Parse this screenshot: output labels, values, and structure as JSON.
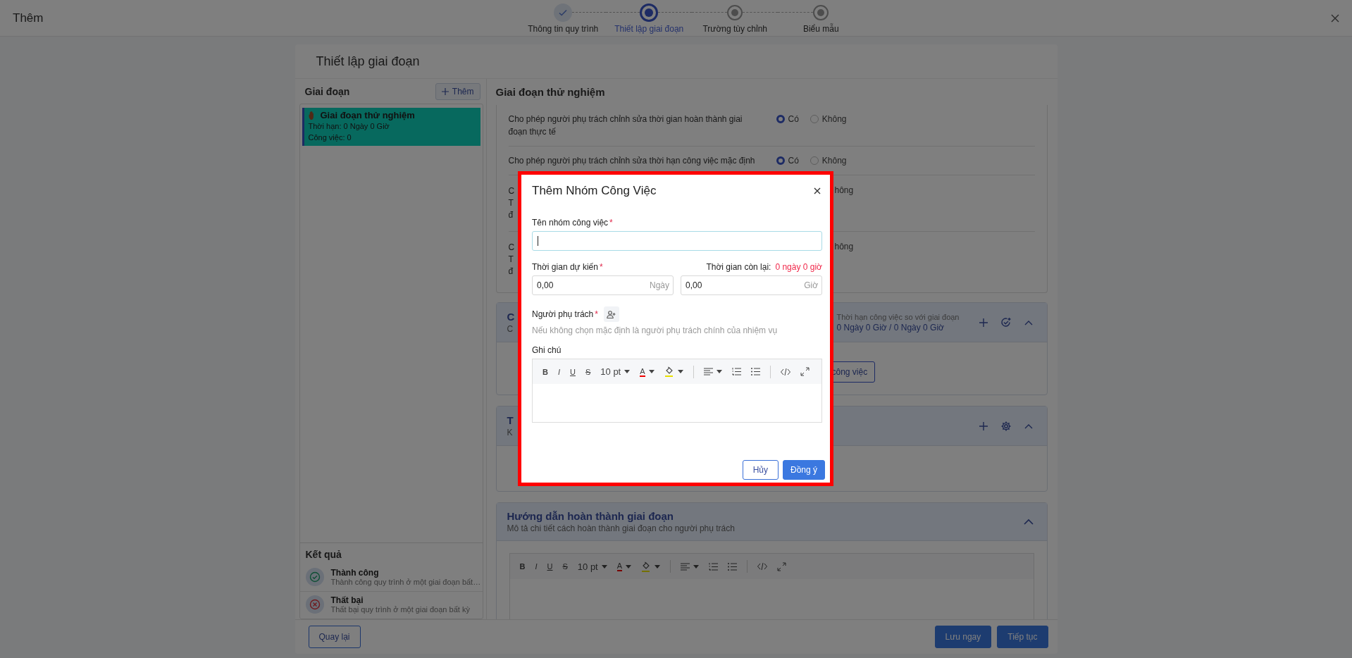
{
  "window": {
    "title": "Thêm"
  },
  "stepper": [
    {
      "label": "Thông tin quy trình",
      "completed": true,
      "selected": false
    },
    {
      "label": "Thiết lập giai đoạn",
      "completed": false,
      "selected": true
    },
    {
      "label": "Trường tùy chỉnh",
      "completed": false,
      "selected": false
    },
    {
      "label": "Biểu mẫu",
      "completed": false,
      "selected": false
    }
  ],
  "page_title": "Thiết lập giai đoạn",
  "stages_panel": {
    "title": "Giai đoạn",
    "add_button": "Thêm",
    "items": [
      {
        "name": "Giai đoạn thử nghiệm",
        "duration": "Thời hạn: 0 Ngày 0 Giờ",
        "tasks": "Công việc: 0",
        "selected": true
      }
    ]
  },
  "results": {
    "title": "Kết quả",
    "items": [
      {
        "kind": "success",
        "name": "Thành công",
        "description": "Thành công quy trình ở một giai đoạn bất…"
      },
      {
        "kind": "failure",
        "name": "Thất bại",
        "description": "Thất bại quy trình ở một giai đoạn bất kỳ"
      }
    ]
  },
  "stage_detail": {
    "title": "Giai đoạn thử nghiệm",
    "settings": [
      {
        "kind": "full",
        "label": "Cho phép người phụ trách chỉnh sửa thời gian hoàn thành giai đoạn thực tế",
        "options": [
          {
            "label": "Có",
            "selected": true
          },
          {
            "label": "Không",
            "selected": false
          }
        ]
      },
      {
        "kind": "full",
        "label": "Cho phép người phụ trách chỉnh sửa thời hạn công việc mặc định",
        "options": [
          {
            "label": "Có",
            "selected": true
          },
          {
            "label": "Không",
            "selected": false
          }
        ]
      },
      {
        "kind": "partial",
        "fragments": [
          "C",
          "T",
          "đ"
        ],
        "option_fragment": "hông"
      },
      {
        "kind": "partial",
        "fragments": [
          "C",
          "T",
          "đ"
        ],
        "option_fragment": "hông"
      }
    ],
    "tasks_section": {
      "title_fragment": "C",
      "subtitle_fragment": "C",
      "deadline_label": "Thời hạn công việc so với giai đoạn",
      "deadline_value": "0 Ngày 0 Giờ / 0 Ngày 0 Giờ",
      "button_fragment": "công việc",
      "expanded": true
    },
    "triggers_section": {
      "title_fragment": "T",
      "subtitle_fragment": "K",
      "expanded": true
    },
    "guide_section": {
      "title": "Hướng dẫn hoàn thành giai đoạn",
      "subtitle": "Mô tả chi tiết cách hoàn thành giai đoạn cho người phụ trách",
      "expanded": true,
      "editor": {
        "bold": "B",
        "italic": "I",
        "underline": "U",
        "strike": "S",
        "font_size": "10 pt",
        "text_color": "A"
      }
    }
  },
  "dialog": {
    "title": "Thêm Nhóm Công Việc",
    "name_field": {
      "label": "Tên nhóm công việc",
      "required_mark": "*",
      "focused": true
    },
    "duration": {
      "label": "Thời gian dự kiến",
      "required_mark": "*",
      "remaining_label": "Thời gian còn lại:",
      "remaining_value": "0 ngày 0 giờ",
      "days": {
        "value": "0,00",
        "unit": "Ngày"
      },
      "hours": {
        "value": "0,00",
        "unit": "Giờ"
      }
    },
    "assignee": {
      "label": "Người phụ trách",
      "required_mark": "*",
      "hint": "Nếu không chọn mặc định là người phụ trách chính của nhiệm vụ"
    },
    "note": {
      "label": "Ghi chú",
      "editor": {
        "bold": "B",
        "italic": "I",
        "underline": "U",
        "strike": "S",
        "font_size": "10 pt",
        "text_color": "A"
      }
    },
    "buttons": [
      {
        "label": "Hủy",
        "kind": "secondary"
      },
      {
        "label": "Đồng ý",
        "kind": "primary"
      }
    ]
  },
  "footer": {
    "back": "Quay lại",
    "save": "Lưu ngay",
    "next": "Tiếp tục"
  }
}
